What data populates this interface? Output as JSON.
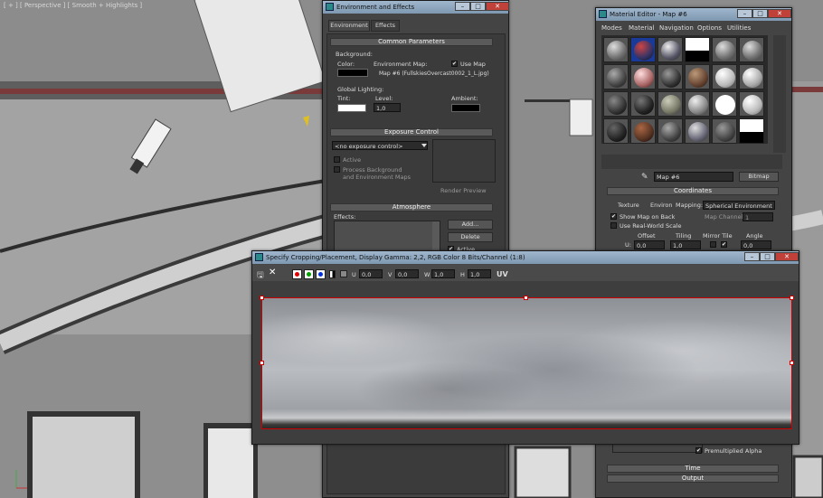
{
  "viewport": {
    "label": "[ + ] [ Perspective ] [ Smooth + Highlights ]"
  },
  "env": {
    "title": "Environment and Effects",
    "tabs": [
      "Environment",
      "Effects"
    ],
    "common_title": "Common Parameters",
    "background_label": "Background:",
    "color_label": "Color:",
    "env_map_label": "Environment Map:",
    "use_map_label": "Use Map",
    "use_map_checked": true,
    "map_name": "Map #6  (FullskiesOvercast0002_1_L.jpg)",
    "global_label": "Global Lighting:",
    "tint_label": "Tint:",
    "level_label": "Level:",
    "level_value": "1,0",
    "ambient_label": "Ambient:",
    "exposure_title": "Exposure Control",
    "exposure_value": "<no exposure control>",
    "active_label": "Active",
    "process_label1": "Process Background",
    "process_label2": "and Environment Maps",
    "render_preview": "Render Preview",
    "atmo_title": "Atmosphere",
    "effects_label": "Effects:",
    "add_label": "Add...",
    "delete_label": "Delete",
    "active2_label": "Active"
  },
  "mat": {
    "title": "Material Editor - Map #6",
    "menu": [
      "Modes",
      "Material",
      "Navigation",
      "Options",
      "Utilities"
    ],
    "map_name": "Map #6",
    "bitmap_label": "Bitmap",
    "coords_title": "Coordinates",
    "texture_label": "Texture",
    "environ_label": "Environ",
    "mapping_label": "Mapping:",
    "mapping_value": "Spherical Environment",
    "show_map_label": "Show Map on Back",
    "map_channel_label": "Map Channel:",
    "map_channel_value": "1",
    "real_world_label": "Use Real-World Scale",
    "offset_label": "Offset",
    "tiling_label": "Tiling",
    "mirror_label": "Mirror Tile",
    "angle_label": "Angle",
    "u_label": "U:",
    "u_offset": "0,0",
    "u_tiling": "1,0",
    "u_angle": "0,0",
    "premult_label": "Premultiplied Alpha",
    "time_label": "Time",
    "output_label": "Output"
  },
  "crop": {
    "title": "Specify Cropping/Placement, Display Gamma: 2,2, RGB Color 8 Bits/Channel (1:8)",
    "u_label": "U",
    "u_value": "0,0",
    "v_label": "V",
    "v_value": "0,0",
    "w_label": "W",
    "w_value": "1,0",
    "h_label": "H",
    "h_value": "1,0",
    "uv_label": "UV",
    "channel_colors": [
      "#e00000",
      "#00a000",
      "#0030e0"
    ]
  }
}
